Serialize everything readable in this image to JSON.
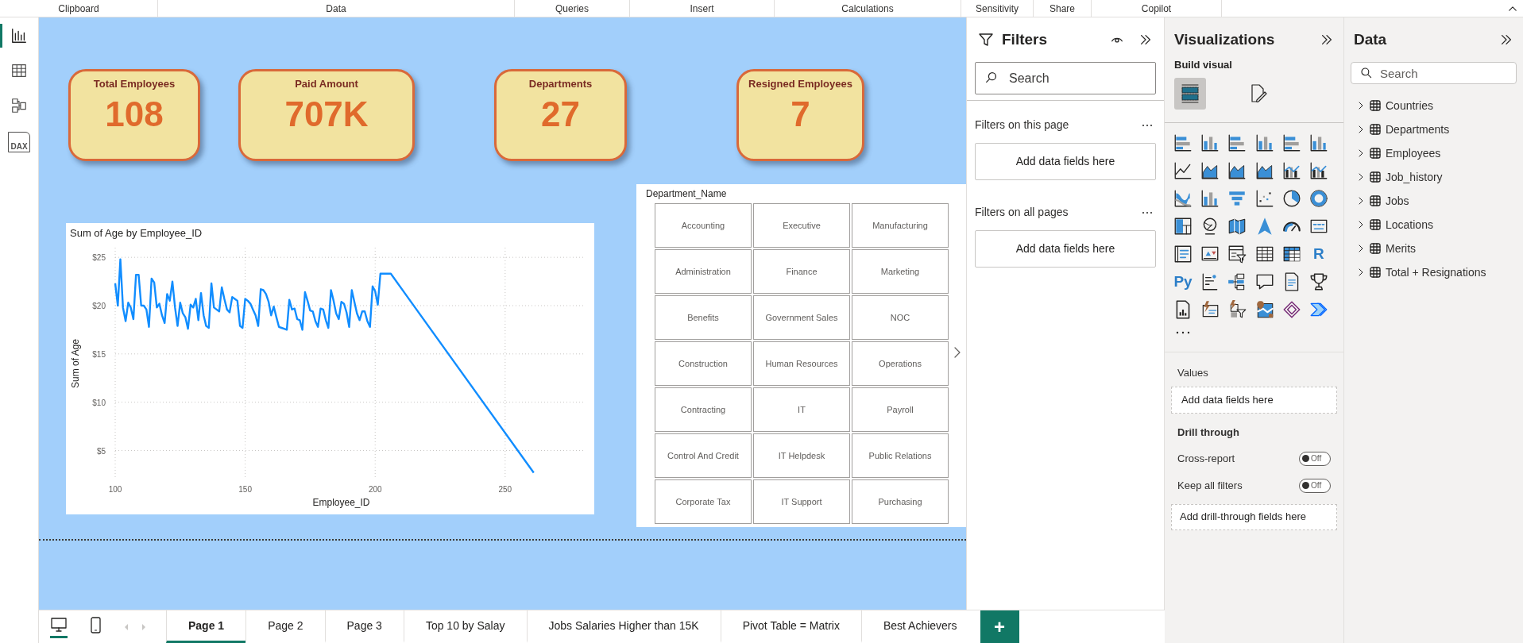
{
  "ribbon_groups": [
    "Clipboard",
    "Data",
    "Queries",
    "Insert",
    "Calculations",
    "Sensitivity",
    "Share",
    "Copilot"
  ],
  "left_rail": [
    {
      "kind": "report",
      "selected": true
    },
    {
      "kind": "table",
      "selected": false
    },
    {
      "kind": "model",
      "selected": false
    },
    {
      "kind": "dax",
      "label": "DAX",
      "selected": false
    }
  ],
  "cards": [
    {
      "title": "Total Employees",
      "value": "108"
    },
    {
      "title": "Paid Amount",
      "value": "707K"
    },
    {
      "title": "Departments",
      "value": "27"
    },
    {
      "title": "Resigned Employees",
      "value": "7"
    }
  ],
  "line_chart": {
    "chart_data": {
      "type": "line",
      "title": "Sum of Age by Employee_ID",
      "xlabel": "Employee_ID",
      "ylabel": "Sum of Age",
      "xlim": [
        100,
        280
      ],
      "ylim": [
        2,
        26
      ],
      "xticks": [
        100,
        150,
        200,
        250
      ],
      "yticks": [
        {
          "value": 5,
          "label": "$5"
        },
        {
          "value": 10,
          "label": "$10"
        },
        {
          "value": 15,
          "label": "$15"
        },
        {
          "value": 20,
          "label": "$20"
        },
        {
          "value": 25,
          "label": "$25"
        }
      ],
      "x": [
        100,
        101,
        102,
        103,
        104,
        105,
        106,
        107,
        108,
        109,
        110,
        111,
        112,
        113,
        114,
        115,
        116,
        117,
        118,
        119,
        120,
        121,
        122,
        123,
        124,
        125,
        126,
        127,
        128,
        129,
        130,
        131,
        132,
        133,
        134,
        135,
        136,
        137,
        138,
        139,
        140,
        141,
        142,
        143,
        144,
        145,
        146,
        147,
        148,
        149,
        150,
        151,
        152,
        153,
        154,
        155,
        156,
        157,
        158,
        159,
        160,
        161,
        162,
        163,
        164,
        165,
        166,
        167,
        168,
        169,
        170,
        171,
        172,
        173,
        174,
        175,
        176,
        177,
        178,
        179,
        180,
        181,
        182,
        183,
        184,
        185,
        186,
        187,
        188,
        189,
        190,
        191,
        192,
        193,
        194,
        195,
        196,
        197,
        198,
        199,
        200,
        201,
        202,
        203,
        204,
        205,
        206,
        261
      ],
      "grid": true,
      "series": [
        {
          "color": "#118dff",
          "values": [
            22.3,
            20,
            24.8,
            19.8,
            18.4,
            20.3,
            19.8,
            18.6,
            23.2,
            23.2,
            20,
            20,
            19.6,
            17.8,
            22.8,
            22.4,
            19.8,
            20.2,
            19,
            18.2,
            21.2,
            20.5,
            22.5,
            19.8,
            17.9,
            20.3,
            19.2,
            18.8,
            17.6,
            20.1,
            19.8,
            20.7,
            18.5,
            21.3,
            19,
            17.9,
            17.7,
            22.3,
            19.8,
            19.6,
            19.4,
            21.9,
            20.7,
            19.6,
            19.3,
            20.9,
            20.7,
            20.5,
            17.9,
            17.7,
            20.7,
            20.5,
            20.2,
            19.6,
            19,
            17.9,
            21.7,
            21.6,
            21.2,
            20.4,
            19,
            19.9,
            18.8,
            17.8,
            17.7,
            17.6,
            17.5,
            20.6,
            19.6,
            19.7,
            18.6,
            18.5,
            17.5,
            21.4,
            20.5,
            19.5,
            19.4,
            18.4,
            17.8,
            19.7,
            19.6,
            18.5,
            17.7,
            21.6,
            20.5,
            19.2,
            18.6,
            20.4,
            20.2,
            19.3,
            17.8,
            21.6,
            20.4,
            19.2,
            18.5,
            19.4,
            19.4,
            18.4,
            17.8,
            22,
            21.5,
            20.1,
            23.3,
            23.3,
            23.3,
            23.3,
            23.3,
            2.7
          ]
        }
      ]
    }
  },
  "slicer": {
    "title": "Department_Name",
    "items": [
      "Accounting",
      "Executive",
      "Manufacturing",
      "Administration",
      "Finance",
      "Marketing",
      "Benefits",
      "Government Sales",
      "NOC",
      "Construction",
      "Human Resources",
      "Operations",
      "Contracting",
      "IT",
      "Payroll",
      "Control And Credit",
      "IT Helpdesk",
      "Public Relations",
      "Corporate Tax",
      "IT Support",
      "Purchasing"
    ]
  },
  "filters": {
    "title": "Filters",
    "search": {
      "placeholder": "Search"
    },
    "sections": [
      {
        "title": "Filters on this page",
        "drop_zone": "Add data fields here"
      },
      {
        "title": "Filters on all pages",
        "drop_zone": "Add data fields here"
      }
    ]
  },
  "visualizations": {
    "title": "Visualizations",
    "subtitle": "Build visual",
    "modes": [
      {
        "kind": "build",
        "selected": true
      },
      {
        "kind": "format",
        "selected": false
      }
    ],
    "icons": [
      {
        "kind": "bar"
      },
      {
        "kind": "column"
      },
      {
        "kind": "bar"
      },
      {
        "kind": "column"
      },
      {
        "kind": "bar"
      },
      {
        "kind": "column"
      },
      {
        "kind": "line"
      },
      {
        "kind": "area"
      },
      {
        "kind": "area"
      },
      {
        "kind": "area"
      },
      {
        "kind": "combo"
      },
      {
        "kind": "combo"
      },
      {
        "kind": "ribbon"
      },
      {
        "kind": "column"
      },
      {
        "kind": "funnel"
      },
      {
        "kind": "scatter"
      },
      {
        "kind": "pie"
      },
      {
        "kind": "donut"
      },
      {
        "kind": "treemap"
      },
      {
        "kind": "globe"
      },
      {
        "kind": "map"
      },
      {
        "kind": "arrow"
      },
      {
        "kind": "gauge"
      },
      {
        "kind": "card"
      },
      {
        "kind": "list"
      },
      {
        "kind": "kpi"
      },
      {
        "kind": "slicer"
      },
      {
        "kind": "table"
      },
      {
        "kind": "matrix"
      },
      {
        "kind": "glyph",
        "glyph": "R"
      },
      {
        "kind": "glyph",
        "glyph": "Py"
      },
      {
        "kind": "influencers"
      },
      {
        "kind": "tree"
      },
      {
        "kind": "bubble"
      },
      {
        "kind": "document"
      },
      {
        "kind": "trophy"
      },
      {
        "kind": "paginated"
      },
      {
        "kind": "flash-card"
      },
      {
        "kind": "flash-slicer"
      },
      {
        "kind": "pin-map"
      },
      {
        "kind": "diamond"
      },
      {
        "kind": "chevrons"
      }
    ],
    "values": {
      "title": "Values",
      "drop_zone": "Add data fields here"
    },
    "drill_through": {
      "title": "Drill through",
      "options": [
        {
          "label": "Cross-report",
          "toggle": "Off",
          "on": false
        },
        {
          "label": "Keep all filters",
          "toggle": "Off",
          "on": false
        }
      ],
      "drop_zone": "Add drill-through fields here"
    }
  },
  "data": {
    "title": "Data",
    "search": {
      "placeholder": "Search"
    },
    "tables": [
      {
        "name": "Countries",
        "expanded": false
      },
      {
        "name": "Departments",
        "expanded": false
      },
      {
        "name": "Employees",
        "expanded": false
      },
      {
        "name": "Job_history",
        "expanded": false
      },
      {
        "name": "Jobs",
        "expanded": false
      },
      {
        "name": "Locations",
        "expanded": false
      },
      {
        "name": "Merits",
        "expanded": false
      },
      {
        "name": "Total + Resignations",
        "expanded": false
      }
    ]
  },
  "view_modes": [
    {
      "kind": "desktop",
      "selected": true
    },
    {
      "kind": "mobile",
      "selected": false
    }
  ],
  "page_tabs": [
    {
      "label": "Page 1",
      "selected": true
    },
    {
      "label": "Page 2",
      "selected": false
    },
    {
      "label": "Page 3",
      "selected": false
    },
    {
      "label": "Top 10 by Salay",
      "selected": false
    },
    {
      "label": "Jobs Salaries Higher than 15K",
      "selected": false
    },
    {
      "label": "Pivot Table = Matrix",
      "selected": false
    },
    {
      "label": "Best Achievers",
      "selected": false
    }
  ],
  "add_page": "+"
}
